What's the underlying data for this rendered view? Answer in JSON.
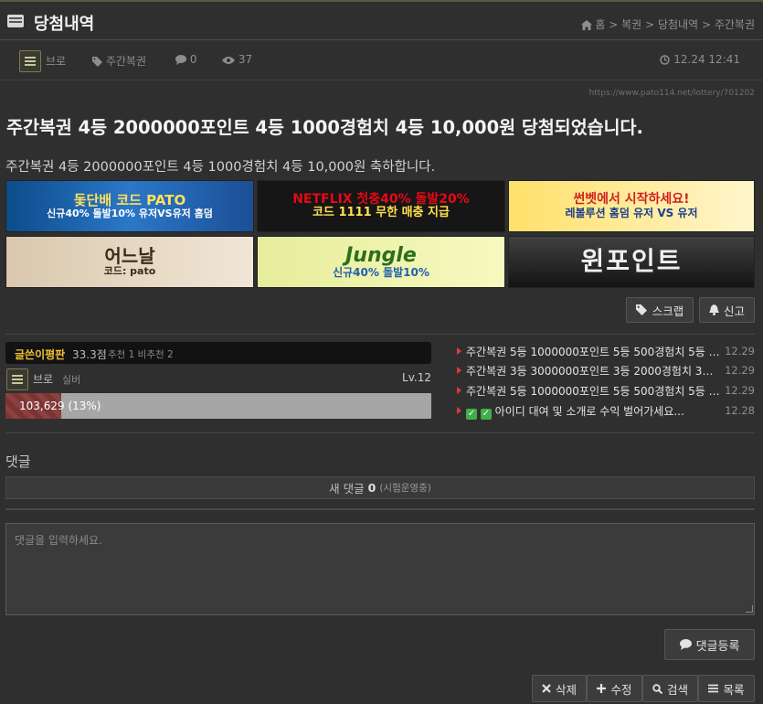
{
  "page": {
    "title": "당첨내역",
    "breadcrumb": {
      "home": "홈",
      "sep": ">",
      "items": [
        "복권",
        "당첨내역",
        "주간복권"
      ]
    }
  },
  "post_meta": {
    "author": "브로",
    "category": "주간복권",
    "comments": "0",
    "views": "37",
    "datetime": "12.24 12:41"
  },
  "post": {
    "url": "https://www.pato114.net/lottery/701202",
    "subject": "주간복권 4등 2000000포인트 4등 1000경험치 4등 10,000원 당첨되었습니다.",
    "body": "주간복권 4등 2000000포인트 4등 1000경험치 4등 10,000원 축하합니다."
  },
  "banners": [
    {
      "name": "banner-dolddanbae",
      "line1": "돛단배 코드 PATO",
      "line2": "신규40% 돌발10% 유저VS유저 홈덤"
    },
    {
      "name": "banner-netflix",
      "line1": "NETFLIX 첫충40% 돌발20%",
      "line2": "코드 1111 무한 매충 지급"
    },
    {
      "name": "banner-sunbet",
      "line1": "썬벳에서 시작하세요!",
      "line2": "레볼루션 홈덤 유저 VS 유저"
    },
    {
      "name": "banner-eoneunal",
      "line1": "어느날",
      "line2": "코드: pato"
    },
    {
      "name": "banner-jungle",
      "line1": "Jungle",
      "line2": "신규40% 돌발10%"
    },
    {
      "name": "banner-winpoint",
      "line1": "윈포인트",
      "line2": ""
    }
  ],
  "actions": {
    "scrap": "스크랩",
    "report": "신고"
  },
  "rating": {
    "title": "글쓴이평판",
    "score": "33.3점",
    "sub": "추천 1 비추천 2",
    "author": "브로",
    "rank": "실버",
    "level": "Lv.12",
    "exp_text": "103,629 (13%)",
    "exp_fraction": 0.13
  },
  "related": [
    {
      "title": "주간복권 5등 1000000포인트 5등 500경험치 5등 0...",
      "date": "12.29"
    },
    {
      "title": "주간복권 3등 3000000포인트 3등 2000경험치 3등 ...",
      "date": "12.29"
    },
    {
      "title": "주간복권 5등 1000000포인트 5등 500경험치 5등 0...",
      "date": "12.29"
    },
    {
      "title": "아이디 대여 및 소개로 수익 벌어가세요...",
      "date": "12.28"
    }
  ],
  "comments": {
    "heading": "댓글",
    "new_label": "새 댓글",
    "new_count": "0",
    "new_note": "(시험운영중)",
    "placeholder": "댓글을 입력하세요.",
    "submit": "댓글등록"
  },
  "bottom_buttons": {
    "delete": "삭제",
    "edit": "수정",
    "search": "검색",
    "list": "목록"
  },
  "colors": {
    "background": "#2f2f2f",
    "accent_red": "#e23a3a",
    "rating_gold": "#f1c232"
  }
}
